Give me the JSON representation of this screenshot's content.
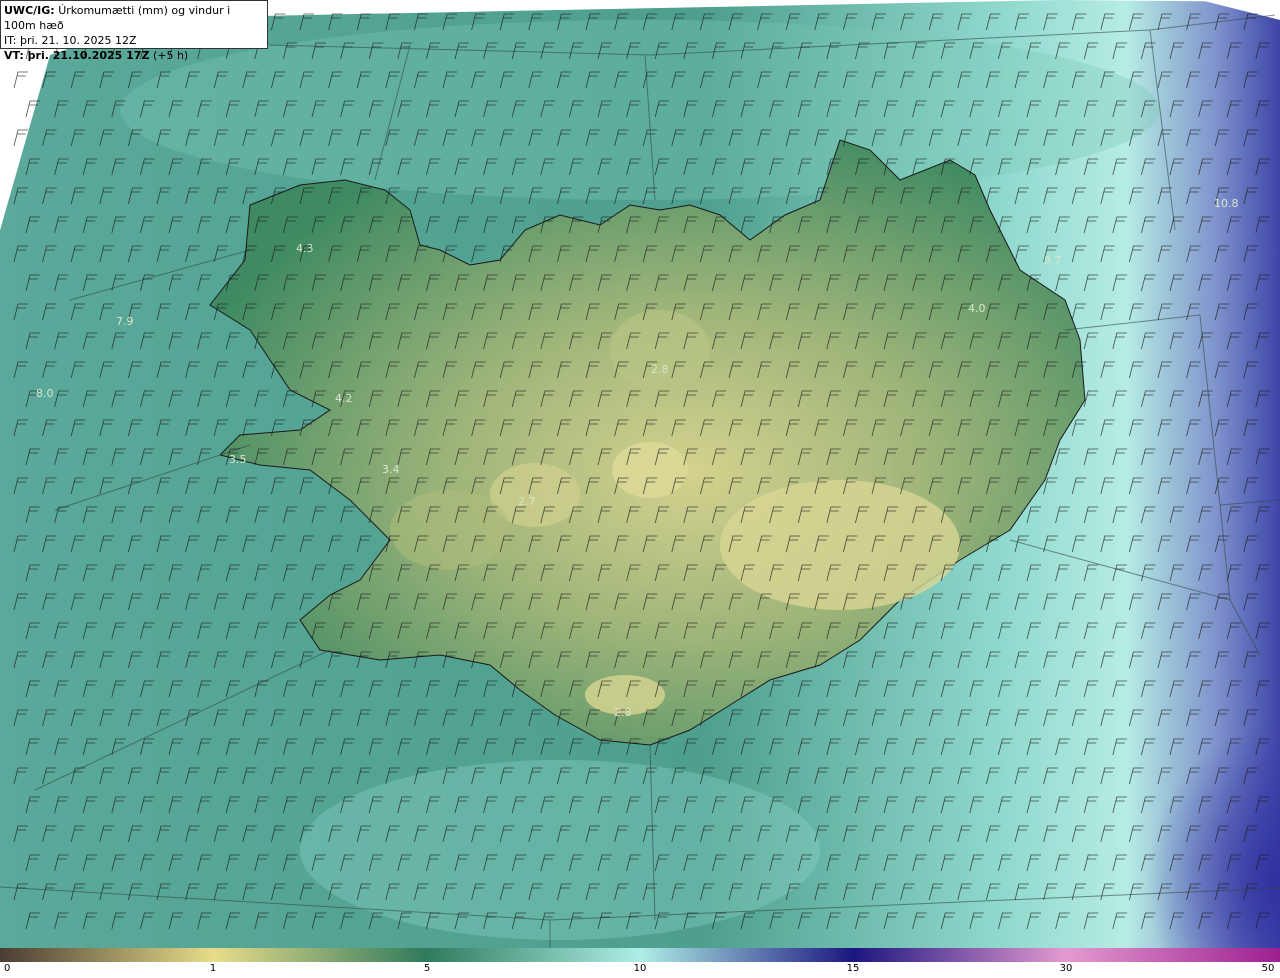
{
  "header": {
    "model": "UWC/IG:",
    "title": "Úrkomumætti (mm) og vindur i 100m hæð",
    "init_time": "IT: þri. 21. 10. 2025 12Z",
    "valid_label": "VT: þri. 21.10.2025 17Z",
    "valid_offset": "(+5 h)"
  },
  "precip_labels": [
    {
      "text": "4.3"
    },
    {
      "text": "7.9"
    },
    {
      "text": "8.0"
    },
    {
      "text": "4.2"
    },
    {
      "text": "3.5"
    },
    {
      "text": "3.4"
    },
    {
      "text": "2.7"
    },
    {
      "text": "2.8"
    },
    {
      "text": "4.0"
    },
    {
      "text": "9.7"
    },
    {
      "text": "10.8"
    },
    {
      "text": "2.8"
    }
  ],
  "colorbar": {
    "ticks": [
      "0",
      "1",
      "5",
      "10",
      "15",
      "30",
      "50"
    ],
    "colors": [
      "#4a3d33",
      "#e8dc8a",
      "#2f7a5c",
      "#aeeee6",
      "#1c1680",
      "#e49ad0",
      "#9c1f8f"
    ]
  },
  "colors": {
    "sea": "#4fa899",
    "land_low": "#3f8a62",
    "land_high": "#cfd08b",
    "heavy_precip": "#3c48a6",
    "barb": "#1a1a1a"
  },
  "wind": {
    "direction": "northeast",
    "speed_knots": 20
  }
}
